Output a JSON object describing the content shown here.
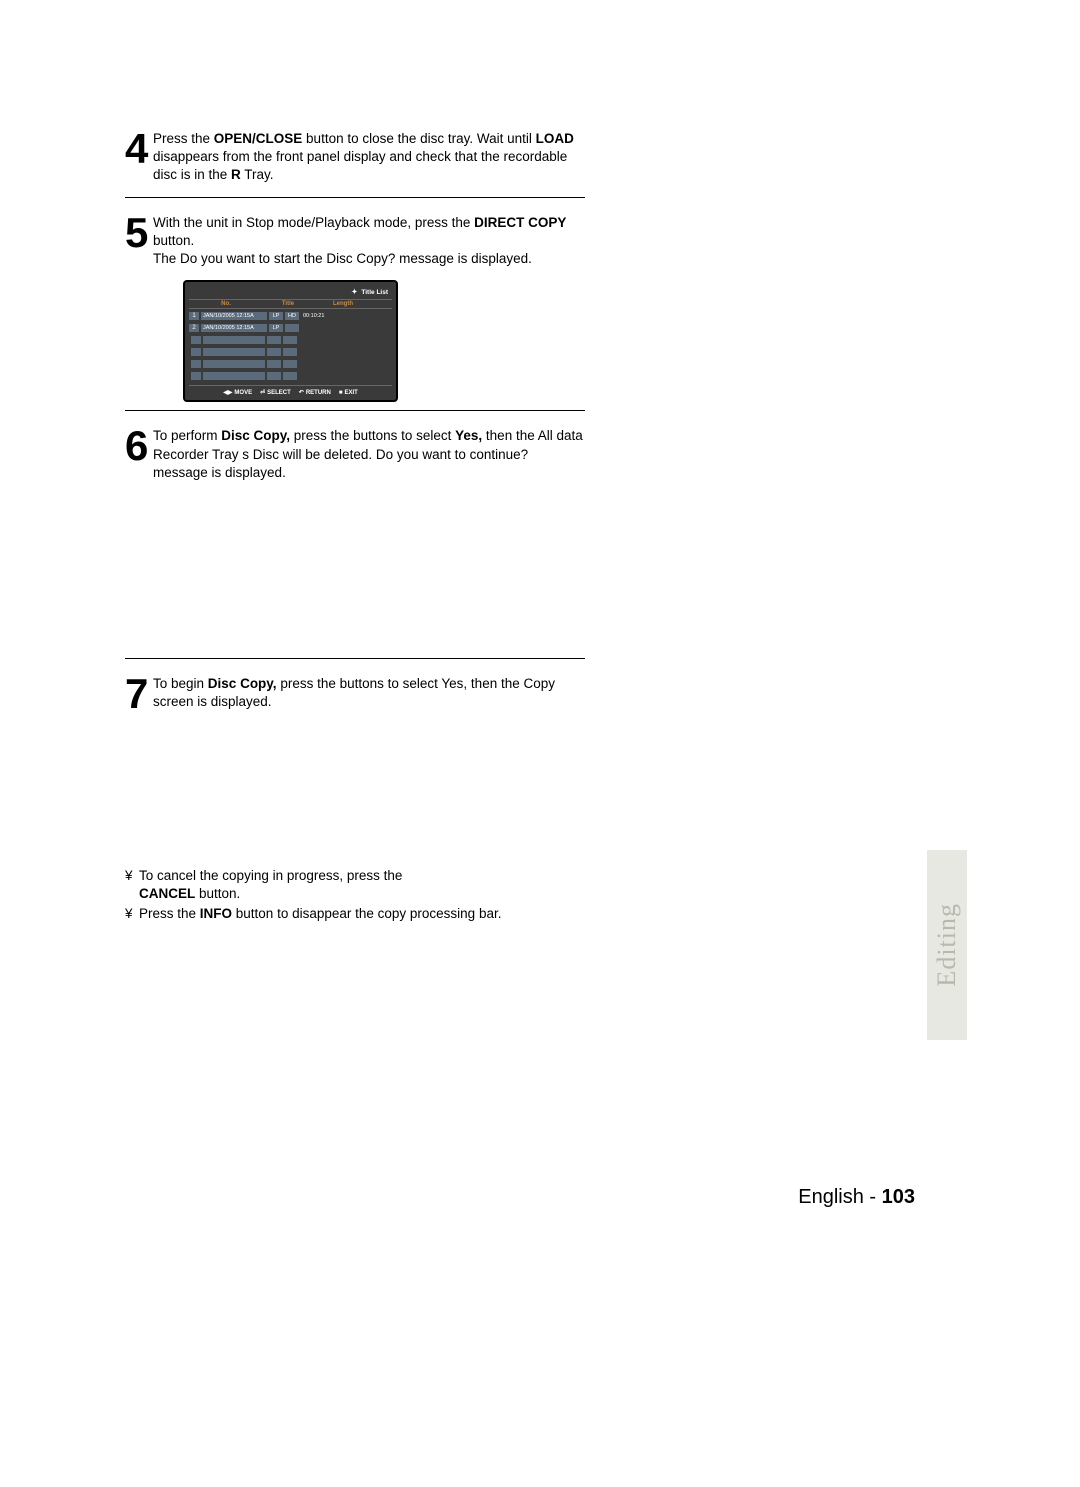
{
  "steps": {
    "s4": {
      "num": "4",
      "line": "Press the OPEN/CLOSE button to close the disc tray. Wait until LOAD disappears from the front panel display and check that the recordable disc is in the R Tray.",
      "b1": "OPEN/CLOSE",
      "b2": "LOAD",
      "b3": "R"
    },
    "s5": {
      "num": "5",
      "l1a": "With the unit in Stop mode/Playback mode, press the ",
      "l1b": "DIRECT COPY",
      "l1c": " button.",
      "l2": "The  Do you want to start the Disc Copy?  message is displayed."
    },
    "s6": {
      "num": "6",
      "a": "To perform ",
      "b": "Disc Copy,",
      "c": " press the          buttons to select ",
      "d": "Yes,",
      "e": " then the  All data Recorder Tray s Disc will be deleted. Do you want to continue?  message is displayed."
    },
    "s7": {
      "num": "7",
      "a": "To begin ",
      "b": "Disc Copy,",
      "c": " press the          buttons to select Yes, then the Copy screen is displayed."
    }
  },
  "screen": {
    "title": "Title List",
    "cols": {
      "no": "No.",
      "title": "Title",
      "length": "Length"
    },
    "rows": [
      {
        "idx": "1",
        "name": "JAN/10/2005 12:15A",
        "t1": "LP",
        "t2": "HD",
        "len": "00:10:21"
      },
      {
        "idx": "2",
        "name": "JAN/10/2005 12:15A",
        "t1": "LP",
        "t2": "",
        "len": ""
      }
    ],
    "hints": {
      "move": "MOVE",
      "select": "SELECT",
      "return": "RETURN",
      "exit": "EXIT"
    }
  },
  "bullets": {
    "b1a": " To cancel the copying in progress, press the ",
    "b1b": "CANCEL",
    "b1c": " button.",
    "b2a": " Press the ",
    "b2b": "INFO",
    "b2c": " button to disappear the copy processing bar.",
    "sym": "¥"
  },
  "side_tab": "Editing",
  "footer": {
    "lang": "English",
    "sep": " - ",
    "page": "103"
  }
}
